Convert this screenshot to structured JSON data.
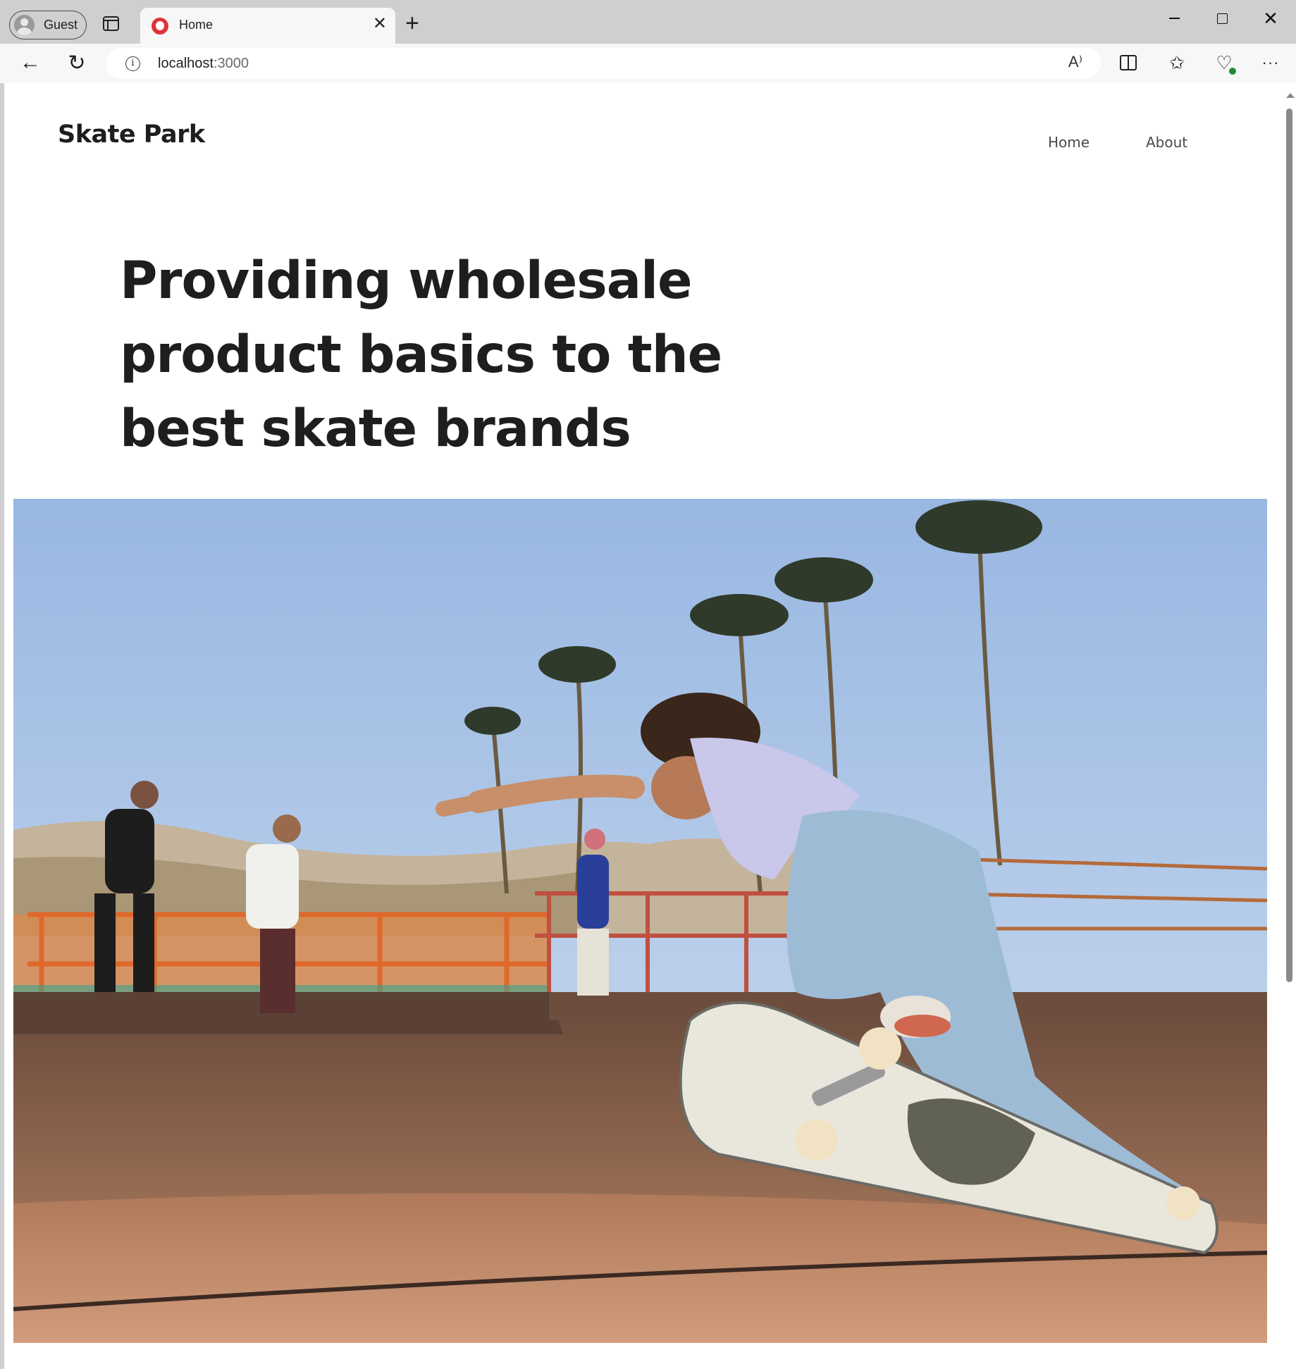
{
  "browser": {
    "profile_label": "Guest",
    "tab": {
      "title": "Home",
      "close_glyph": "✕"
    },
    "new_tab_glyph": "+",
    "window_close_glyph": "✕",
    "address": {
      "host": "localhost",
      "port": ":3000"
    },
    "icons": {
      "back": "arrow-left-icon",
      "refresh": "refresh-icon",
      "info": "info-icon",
      "read_aloud": "read-aloud-icon",
      "split_screen": "split-screen-icon",
      "favorites": "favorites-icon",
      "browser_essentials": "heart-pulse-icon",
      "more": "more-icon"
    },
    "glyphs": {
      "back": "←",
      "refresh": "↻",
      "info": "i",
      "read_aloud": "A⁾",
      "favorites": "✩",
      "health": "♡",
      "more": "···"
    }
  },
  "site": {
    "brand": "Skate Park",
    "nav": [
      {
        "label": "Home"
      },
      {
        "label": "About"
      }
    ],
    "hero": {
      "title": "Providing wholesale product basics to the best skate brands"
    }
  },
  "colors": {
    "tabstrip": "#cfcfcf",
    "toolbar": "#f7f7f7",
    "text_dark": "#1e1e1e",
    "nav_text": "#4a4a4a",
    "sky": "#a9c4e6",
    "ramp": "#a5755a",
    "railing_orange": "#e0682b"
  }
}
